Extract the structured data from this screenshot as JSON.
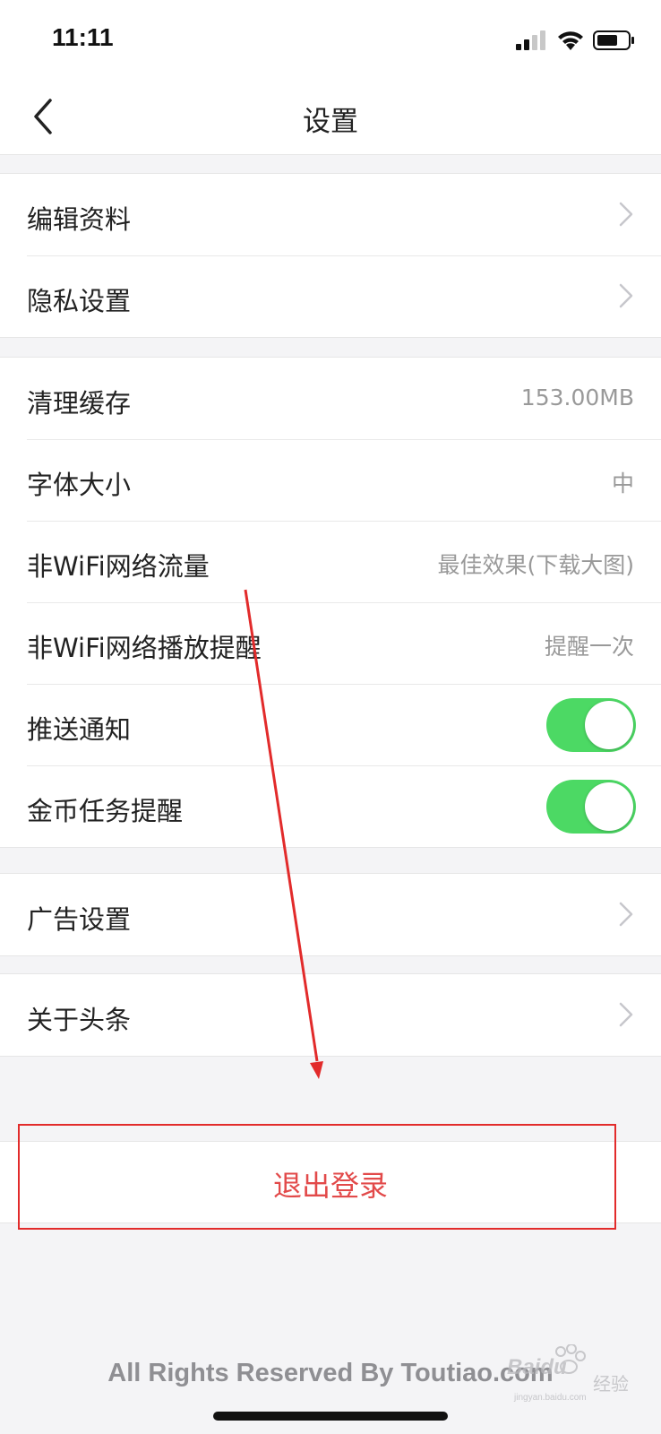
{
  "status_bar": {
    "time": "11:11",
    "signal_icon": "cellular-signal-icon",
    "wifi_icon": "wifi-icon",
    "battery_icon": "battery-icon"
  },
  "nav": {
    "back_icon": "chevron-left-icon",
    "title": "设置"
  },
  "groups": [
    {
      "items": [
        {
          "label": "编辑资料",
          "accessory": "chevron"
        },
        {
          "label": "隐私设置",
          "accessory": "chevron"
        }
      ]
    },
    {
      "items": [
        {
          "label": "清理缓存",
          "value": "153.00MB"
        },
        {
          "label": "字体大小",
          "value": "中"
        },
        {
          "label": "非WiFi网络流量",
          "value": "最佳效果(下载大图)"
        },
        {
          "label": "非WiFi网络播放提醒",
          "value": "提醒一次"
        },
        {
          "label": "推送通知",
          "toggle": true
        },
        {
          "label": "金币任务提醒",
          "toggle": true
        }
      ]
    },
    {
      "items": [
        {
          "label": "广告设置",
          "accessory": "chevron"
        }
      ]
    },
    {
      "items": [
        {
          "label": "关于头条",
          "accessory": "chevron"
        }
      ]
    }
  ],
  "logout": {
    "label": "退出登录"
  },
  "footer": {
    "text": "All Rights Reserved By Toutiao.com"
  },
  "watermark": {
    "brand": "Baidu",
    "brand_cn": "经验",
    "site": "jingyan.baidu.com"
  },
  "colors": {
    "toggle_on": "#4cd964",
    "logout_text": "#e24a4a",
    "annotation_red": "#e22b2b"
  }
}
